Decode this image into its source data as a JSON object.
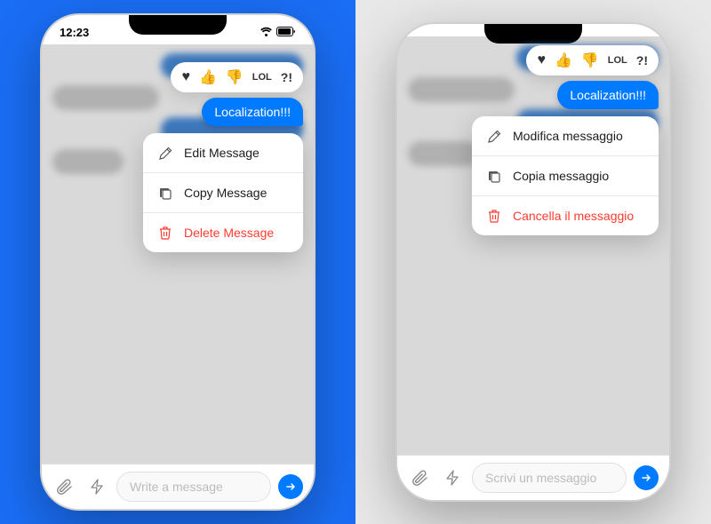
{
  "left_phone": {
    "status_bar": {
      "time": "12:23",
      "wifi": "wifi",
      "battery": "battery"
    },
    "reaction_bar": {
      "reactions": [
        "♥",
        "👍",
        "👎",
        "LOL",
        "?!"
      ]
    },
    "message_bubble": {
      "text": "Localization!!!"
    },
    "context_menu": {
      "items": [
        {
          "id": "edit",
          "icon": "edit-icon",
          "label": "Edit Message",
          "danger": false
        },
        {
          "id": "copy",
          "icon": "copy-icon",
          "label": "Copy Message",
          "danger": false
        },
        {
          "id": "delete",
          "icon": "trash-icon",
          "label": "Delete Message",
          "danger": true
        }
      ]
    },
    "input_bar": {
      "attach_icon": "📎",
      "bolt_icon": "⚡",
      "placeholder": "Write a message",
      "send_icon": "→"
    }
  },
  "right_phone": {
    "reaction_bar": {
      "reactions": [
        "♥",
        "👍",
        "👎",
        "LOL",
        "?!"
      ]
    },
    "message_bubble": {
      "text": "Localization!!!"
    },
    "context_menu": {
      "items": [
        {
          "id": "edit",
          "icon": "edit-icon",
          "label": "Modifica messaggio",
          "danger": false
        },
        {
          "id": "copy",
          "icon": "copy-icon",
          "label": "Copia messaggio",
          "danger": false
        },
        {
          "id": "delete",
          "icon": "trash-icon",
          "label": "Cancella il messaggio",
          "danger": true
        }
      ]
    },
    "input_bar": {
      "attach_icon": "📎",
      "bolt_icon": "⚡",
      "placeholder": "Scrivi un messaggio",
      "send_icon": "→"
    }
  }
}
